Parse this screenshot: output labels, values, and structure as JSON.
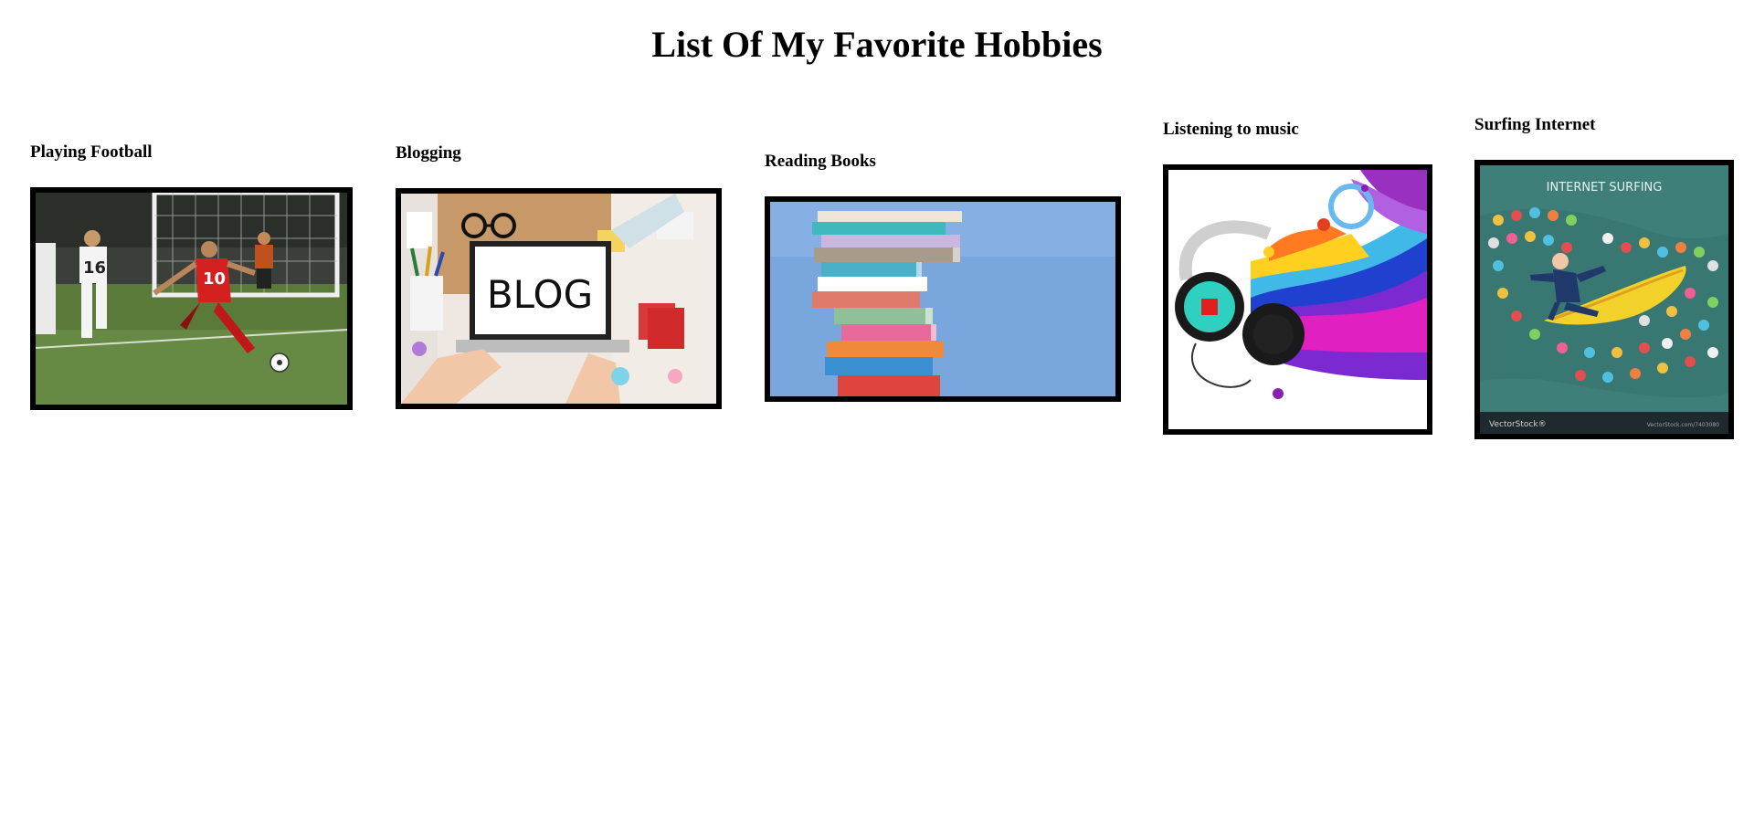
{
  "page": {
    "title": "List Of My Favorite Hobbies"
  },
  "hobbies": [
    {
      "title": "Playing Football",
      "image": "football-photo",
      "jersey_left": "16",
      "jersey_right": "10"
    },
    {
      "title": "Blogging",
      "image": "blog-desk-photo",
      "board_text": "BLOG"
    },
    {
      "title": "Reading Books",
      "image": "book-stack-photo"
    },
    {
      "title": "Listening to music",
      "image": "headphones-music-illustration"
    },
    {
      "title": "Surfing Internet",
      "image": "internet-surfing-illustration",
      "banner_text": "INTERNET SURFING",
      "footer_text": "VectorStock®",
      "footer_right": "VectorStock.com/7403080"
    }
  ],
  "colors": {
    "accent_green": "#3f7f6f",
    "grass": "#5a7a3a",
    "sky_blue": "#6f9fd8"
  }
}
